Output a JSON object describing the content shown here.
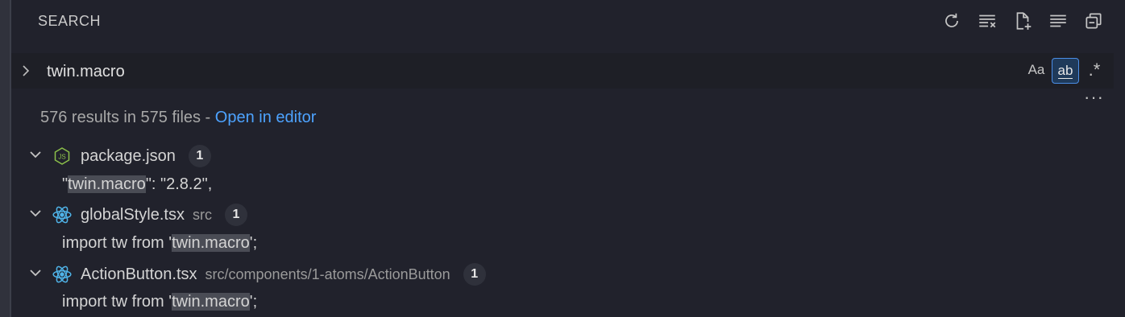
{
  "panel": {
    "title": "SEARCH"
  },
  "toolbar": {
    "actions": [
      {
        "icon": "refresh-icon"
      },
      {
        "icon": "clear-results-icon"
      },
      {
        "icon": "new-search-editor-icon"
      },
      {
        "icon": "view-as-tree-icon"
      },
      {
        "icon": "collapse-all-icon"
      }
    ]
  },
  "search": {
    "query": "twin.macro",
    "options": {
      "match_case": "Aa",
      "match_whole_word": "ab",
      "use_regex": ".*"
    },
    "more_label": "···"
  },
  "summary": {
    "text": "576 results in 575 files - ",
    "link": "Open in editor"
  },
  "results": [
    {
      "file": "package.json",
      "path": "",
      "count": "1",
      "icon": "json-file-icon",
      "match": {
        "before": "\"",
        "hit": "twin.macro",
        "after": "\": \"2.8.2\","
      }
    },
    {
      "file": "globalStyle.tsx",
      "path": "src",
      "count": "1",
      "icon": "react-file-icon",
      "match": {
        "before": "import tw from '",
        "hit": "twin.macro",
        "after": "';"
      }
    },
    {
      "file": "ActionButton.tsx",
      "path": "src/components/1-atoms/ActionButton",
      "count": "1",
      "icon": "react-file-icon",
      "match": {
        "before": "import tw from '",
        "hit": "twin.macro",
        "after": "';"
      }
    }
  ],
  "colors": {
    "background": "#21222c",
    "link": "#4da3ff",
    "highlight": "#4a4c55",
    "active_option_border": "#4b8ee6"
  }
}
